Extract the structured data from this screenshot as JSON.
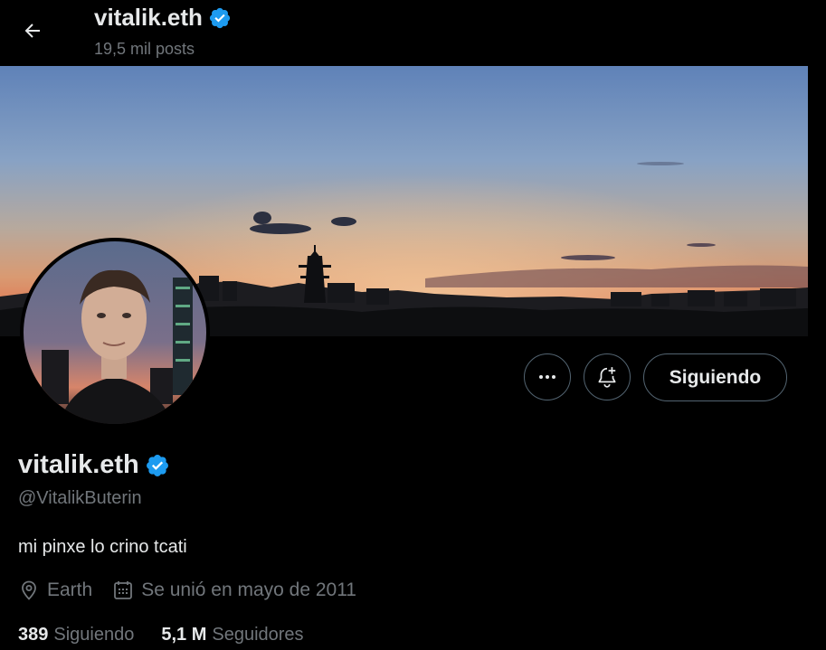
{
  "header": {
    "title": "vitalik.eth",
    "posts_count": "19,5 mil posts"
  },
  "profile": {
    "display_name": "vitalik.eth",
    "handle": "@VitalikButerin",
    "bio": "mi pinxe lo crino tcati",
    "location": "Earth",
    "joined": "Se unió en mayo de 2011",
    "following_count": "389",
    "following_label": "Siguiendo",
    "followers_count": "5,1 M",
    "followers_label": "Seguidores"
  },
  "actions": {
    "more_icon": "more-icon",
    "notify_icon": "bell-plus-icon",
    "follow_label": "Siguiendo"
  },
  "colors": {
    "verified": "#1d9bf0",
    "border": "#536471",
    "muted": "#71767b"
  }
}
